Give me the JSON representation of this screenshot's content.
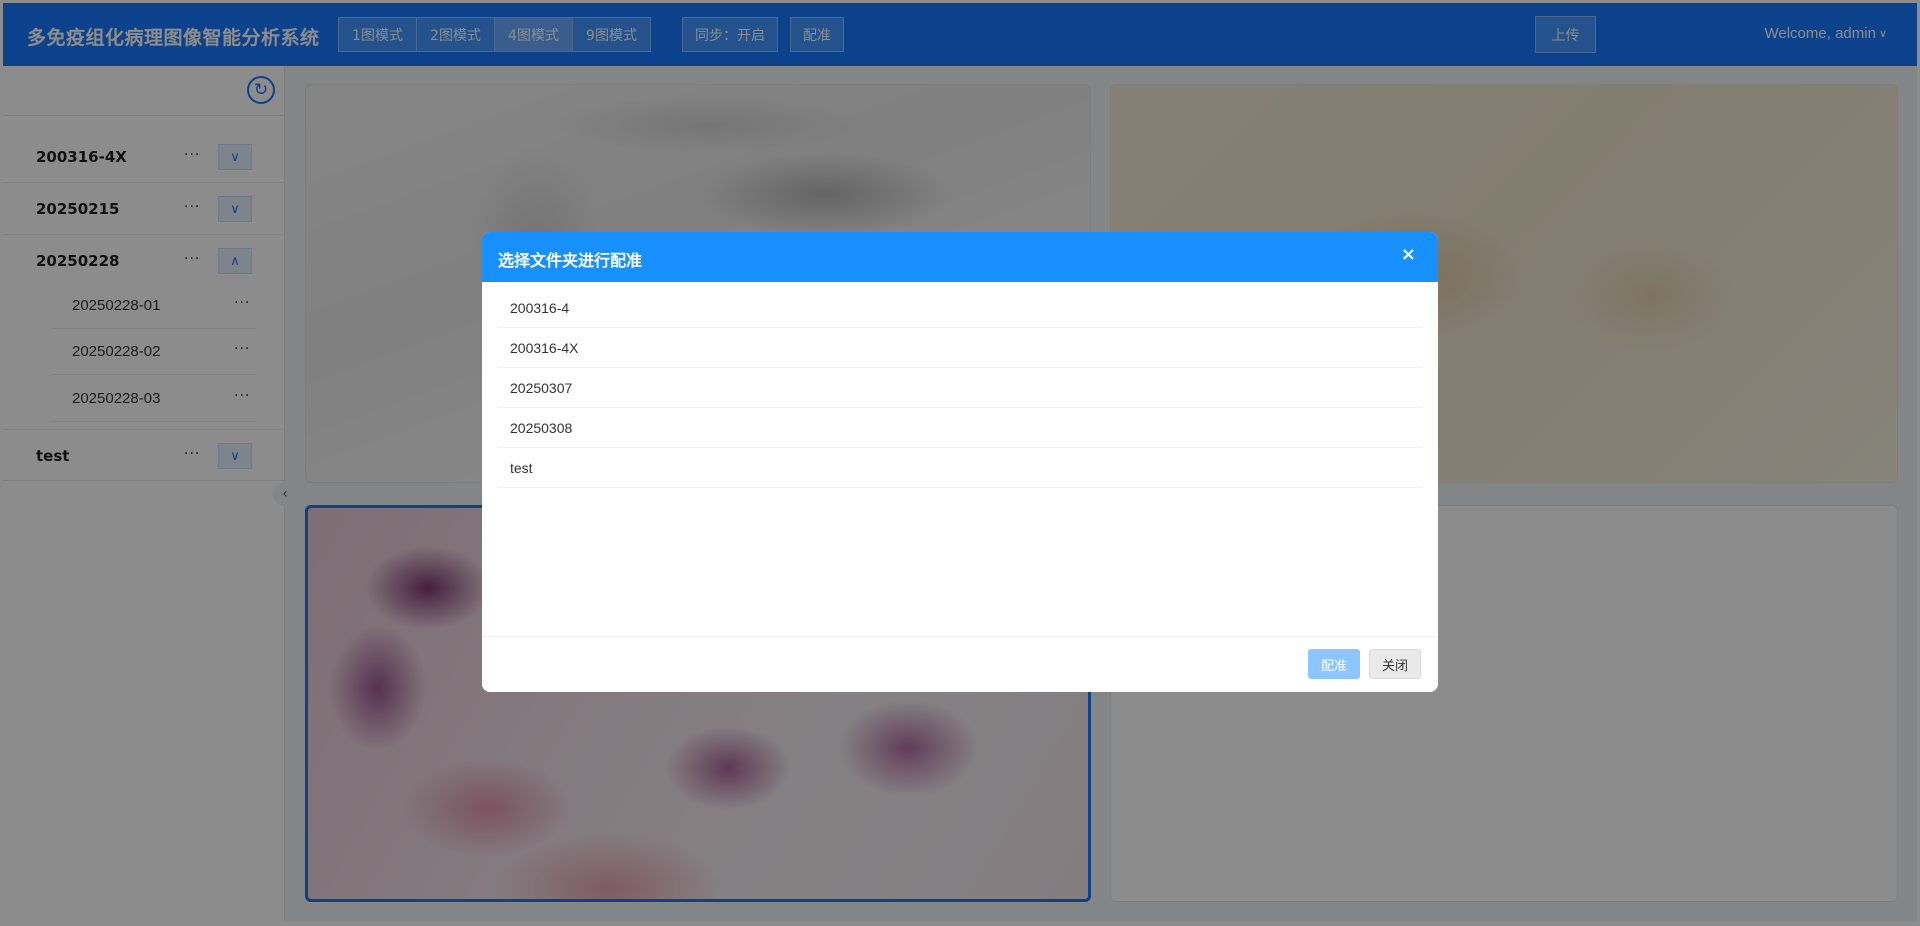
{
  "header": {
    "title": "多免疫组化病理图像智能分析系统",
    "mode_buttons": [
      "1图模式",
      "2图模式",
      "4图模式",
      "9图模式"
    ],
    "sync_label": "同步：开启",
    "register_label": "配准",
    "upload_label": "上传",
    "welcome": "Welcome, admin"
  },
  "sidebar": {
    "folders": [
      {
        "name": "200316-4X",
        "dots": "···",
        "expanded": false
      },
      {
        "name": "20250215",
        "dots": "···",
        "expanded": false
      },
      {
        "name": "20250228",
        "dots": "···",
        "expanded": true,
        "children": [
          "20250228-01",
          "20250228-02",
          "20250228-03"
        ]
      },
      {
        "name": "test",
        "dots": "···",
        "expanded": false
      }
    ]
  },
  "modal": {
    "title": "选择文件夹进行配准",
    "close_icon": "×",
    "folders": [
      "200316-4",
      "200316-4X",
      "20250307",
      "20250308",
      "test"
    ],
    "register_button": "配准",
    "close_button": "关闭"
  },
  "colors": {
    "header": "#1677ff",
    "modal_header": "#1890ff",
    "register_disabled": "#8cc5ff"
  }
}
